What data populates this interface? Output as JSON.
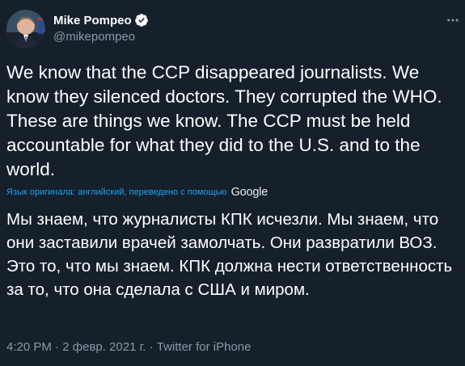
{
  "author": {
    "display_name": "Mike Pompeo",
    "handle": "@mikepompeo",
    "verified": true,
    "avatar_icon": "profile-photo"
  },
  "tweet": {
    "original_text": "We know that the CCP disappeared journalists. We know they silenced doctors. They corrupted the WHO. These are things we know. The CCP must be held accountable for what they did to the U.S. and to the world.",
    "translation_note": "Язык оригинала: английский, переведено с помощью",
    "translation_provider": "Google",
    "translated_text": "Мы знаем, что журналисты КПК исчезли. Мы знаем, что они заставили врачей замолчать. Они развратили ВОЗ. Это то, что мы знаем. КПК должна нести ответственность за то, что она сделала с США и миром.",
    "time": "4:20 PM",
    "date": "2 февр. 2021 г.",
    "source": "Twitter for iPhone",
    "separator": " · "
  },
  "colors": {
    "background": "#15202b",
    "text": "#ffffff",
    "secondary": "#8899a6",
    "accent": "#1da1f2"
  }
}
